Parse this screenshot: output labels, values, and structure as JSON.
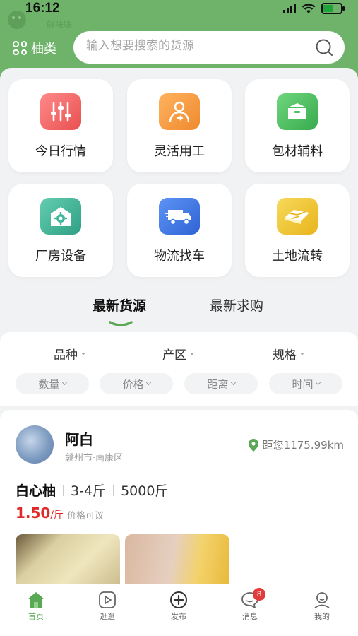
{
  "status_bar": {
    "time": "16:12"
  },
  "header": {
    "brand_text": "鲜味味",
    "category_label": "柚类",
    "search_placeholder": "输入想要搜索的货源"
  },
  "services": [
    {
      "label": "今日行情",
      "icon": "sliders-icon",
      "color": "#f06a6a"
    },
    {
      "label": "灵活用工",
      "icon": "worker-icon",
      "color": "#f4a04a"
    },
    {
      "label": "包材辅料",
      "icon": "box-icon",
      "color": "#4cbf62"
    },
    {
      "label": "厂房设备",
      "icon": "factory-gear-icon",
      "color": "#3fb79a"
    },
    {
      "label": "物流找车",
      "icon": "truck-icon",
      "color": "#3e7ae6"
    },
    {
      "label": "土地流转",
      "icon": "land-icon",
      "color": "#f1c53a"
    }
  ],
  "tabs": [
    {
      "label": "最新货源",
      "active": true
    },
    {
      "label": "最新求购",
      "active": false
    }
  ],
  "filters": {
    "main": [
      "品种",
      "产区",
      "规格"
    ],
    "chips": [
      "数量",
      "价格",
      "距离",
      "时间"
    ]
  },
  "listing": {
    "seller_name": "阿白",
    "seller_location": "赣州市·南康区",
    "distance": "距您1175.99km",
    "product_name": "白心柚",
    "spec": "3-4斤",
    "quantity": "5000斤",
    "price": "1.50",
    "price_unit": "/斤",
    "price_note": "价格可议"
  },
  "tabbar": [
    {
      "label": "首页",
      "icon": "home-icon",
      "active": true
    },
    {
      "label": "逛逛",
      "icon": "play-icon",
      "active": false
    },
    {
      "label": "发布",
      "icon": "plus-circle-icon",
      "active": false
    },
    {
      "label": "消息",
      "icon": "message-icon",
      "active": false,
      "badge": "8"
    },
    {
      "label": "我的",
      "icon": "user-icon",
      "active": false
    }
  ],
  "colors": {
    "brand_green": "#6fb26a",
    "price_red": "#e02a2a",
    "badge_red": "#e23b3b"
  }
}
